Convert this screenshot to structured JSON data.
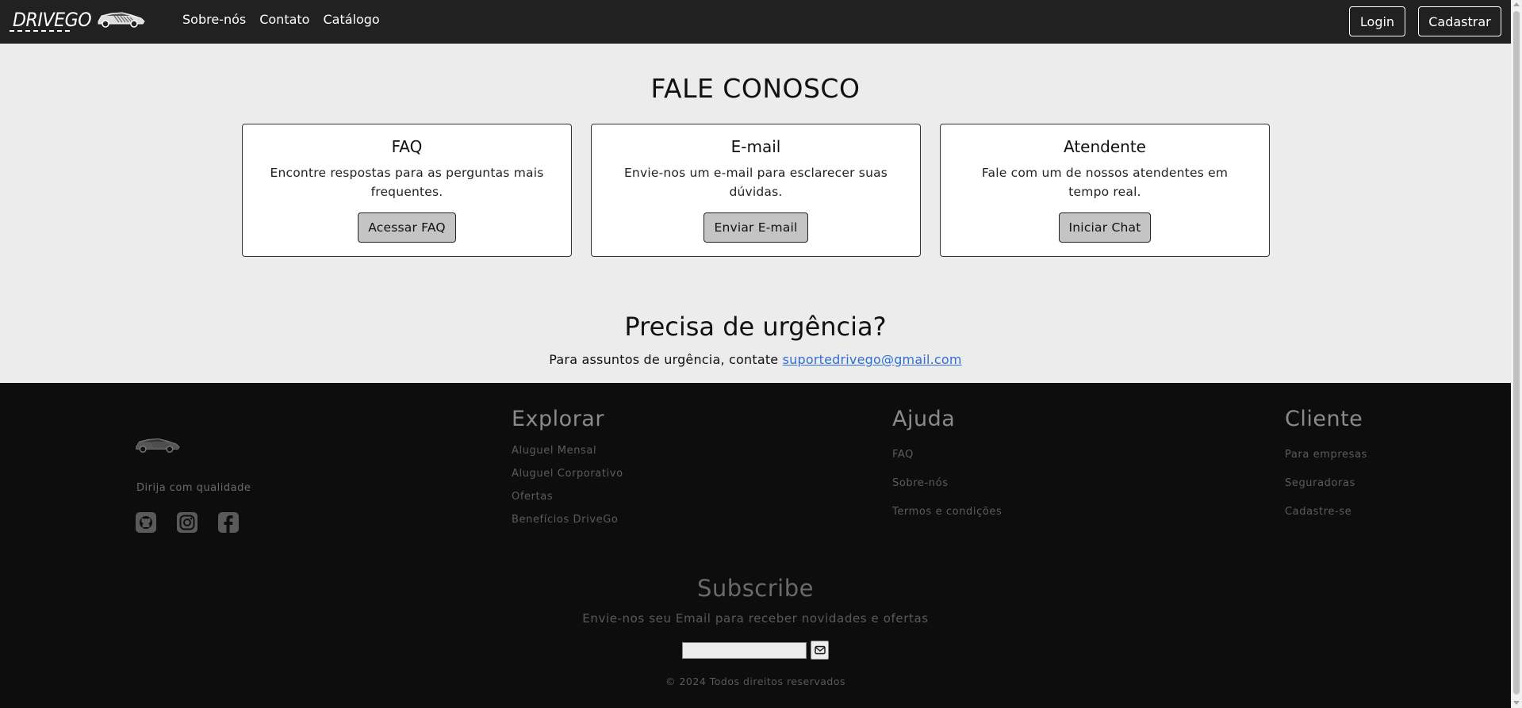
{
  "nav": {
    "logo_text": "DRIVEGO",
    "links": [
      {
        "label": "Sobre-nós"
      },
      {
        "label": "Contato"
      },
      {
        "label": "Catálogo"
      }
    ],
    "login_label": "Login",
    "signup_label": "Cadastrar"
  },
  "contact": {
    "title": "FALE CONOSCO",
    "cards": [
      {
        "title": "FAQ",
        "text": "Encontre respostas para as perguntas mais frequentes.",
        "button": "Acessar FAQ"
      },
      {
        "title": "E-mail",
        "text": "Envie-nos um e-mail para esclarecer suas dúvidas.",
        "button": "Enviar E-mail"
      },
      {
        "title": "Atendente",
        "text": "Fale com um de nossos atendentes em tempo real.",
        "button": "Iniciar Chat"
      }
    ]
  },
  "urgent": {
    "title": "Precisa de urgência?",
    "text": "Para assuntos de urgência, contate ",
    "email": "suportedrivego@gmail.com"
  },
  "footer": {
    "tagline": "Dirija com qualidade",
    "social_icons": [
      "github-icon",
      "instagram-icon",
      "facebook-icon"
    ],
    "columns": [
      {
        "title": "Explorar",
        "items": [
          "Aluguel Mensal",
          "Aluguel Corporativo",
          "Ofertas",
          "Benefícios DriveGo"
        ]
      },
      {
        "title": "Ajuda",
        "items": [
          "FAQ",
          "Sobre-nós",
          "Termos e condições"
        ]
      },
      {
        "title": "Cliente",
        "items": [
          "Para empresas",
          "Seguradoras",
          "Cadastre-se"
        ]
      }
    ],
    "subscribe": {
      "title": "Subscribe",
      "text": "Envie-nos seu Email para receber novidades e ofertas",
      "input_value": "",
      "button_icon": "envelope-icon"
    },
    "copyright": "© 2024 Todos direitos reservados"
  },
  "colors": {
    "navbar_bg": "#212121",
    "page_bg": "#ececec",
    "footer_bg": "#0d0d0d",
    "link": "#2f6fd6",
    "card_button_bg": "#c4c4c4"
  }
}
